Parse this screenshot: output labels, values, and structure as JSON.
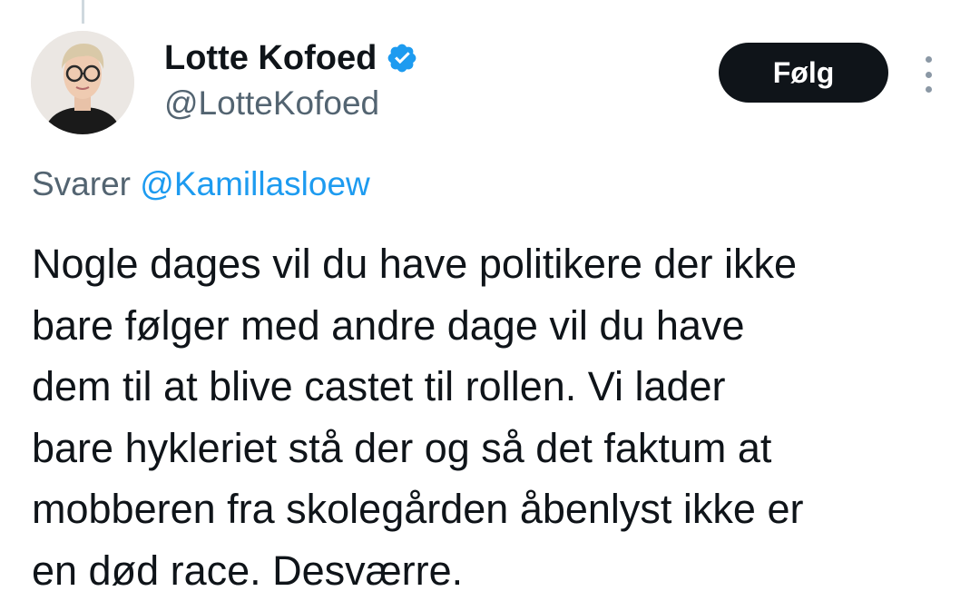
{
  "author": {
    "display_name": "Lotte Kofoed",
    "handle": "@LotteKofoed",
    "verified": true,
    "avatar_icon": "profile-photo"
  },
  "actions": {
    "follow_label": "Følg",
    "more_icon": "more-vertical-icon"
  },
  "reply": {
    "prefix": "Svarer",
    "mention": "@Kamillasloew"
  },
  "tweet": {
    "lines": [
      "Nogle dages vil du have politikere der ikke",
      "bare følger med andre dage vil du have",
      "dem til at blive castet til rollen. Vi lader",
      "bare hykleriet stå der og så det faktum at",
      "mobberen fra skolegården åbenlyst ikke er",
      "en død race. Desværre."
    ]
  },
  "colors": {
    "text": "#0f1419",
    "secondary": "#536471",
    "link": "#1d9bf0",
    "verified_badge": "#1d9bf0",
    "follow_bg": "#0f1419",
    "thread_line": "#cfd9de"
  }
}
